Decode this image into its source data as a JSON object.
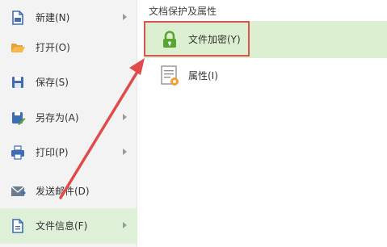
{
  "menu": {
    "items": [
      {
        "label": "新建(N)",
        "icon": "new-doc-icon",
        "has_submenu": true
      },
      {
        "label": "打开(O)",
        "icon": "folder-open-icon",
        "has_submenu": false
      },
      {
        "label": "保存(S)",
        "icon": "save-icon",
        "has_submenu": false
      },
      {
        "label": "另存为(A)",
        "icon": "save-as-icon",
        "has_submenu": true
      },
      {
        "label": "打印(P)",
        "icon": "printer-icon",
        "has_submenu": true
      },
      {
        "label": "发送邮件(D)",
        "icon": "mail-icon",
        "has_submenu": false
      },
      {
        "label": "文件信息(F)",
        "icon": "file-info-icon",
        "has_submenu": true,
        "selected": true
      }
    ]
  },
  "panel": {
    "title": "文档保护及属性",
    "encrypt_label": "文件加密(Y)",
    "properties_label": "属性(I)"
  },
  "colors": {
    "selected_bg": "#dff0d8",
    "highlight_frame": "#d9534f",
    "arrow": "#e04a4a",
    "icon_blue": "#3e6cb5",
    "icon_green": "#5aa532"
  }
}
